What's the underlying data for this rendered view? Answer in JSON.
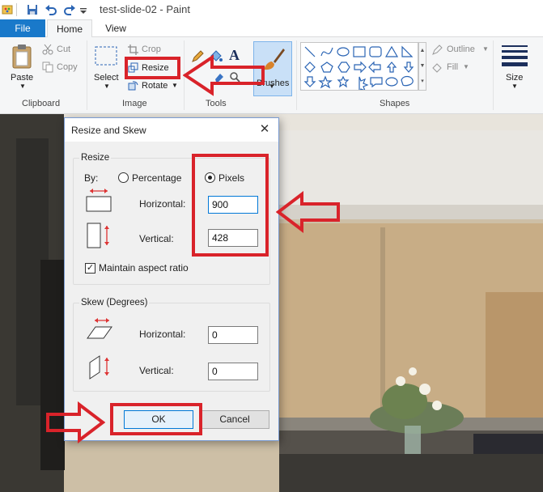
{
  "window": {
    "title": "test-slide-02 - Paint"
  },
  "tabs": {
    "file": "File",
    "home": "Home",
    "view": "View"
  },
  "ribbon": {
    "clipboard": {
      "paste": "Paste",
      "cut": "Cut",
      "copy": "Copy",
      "group": "Clipboard"
    },
    "image": {
      "select": "Select",
      "crop": "Crop",
      "resize": "Resize",
      "rotate": "Rotate",
      "group": "Image"
    },
    "tools": {
      "group": "Tools"
    },
    "brushes": {
      "label": "Brushes"
    },
    "shapes": {
      "outline": "Outline",
      "fill": "Fill",
      "group": "Shapes"
    },
    "size": {
      "label": "Size"
    }
  },
  "dialog": {
    "title": "Resize and Skew",
    "resize": {
      "legend": "Resize",
      "by_label": "By:",
      "percentage": "Percentage",
      "pixels": "Pixels",
      "selected_mode": "Pixels",
      "horizontal_label": "Horizontal:",
      "horizontal_value": "900",
      "vertical_label": "Vertical:",
      "vertical_value": "428",
      "maintain_aspect": "Maintain aspect ratio",
      "maintain_checked": true
    },
    "skew": {
      "legend": "Skew (Degrees)",
      "horizontal_label": "Horizontal:",
      "horizontal_value": "0",
      "vertical_label": "Vertical:",
      "vertical_value": "0"
    },
    "ok": "OK",
    "cancel": "Cancel"
  },
  "colors": {
    "accent": "#1979ca",
    "annotation": "#d9232a",
    "ribbon_bg": "#f5f6f7",
    "dialog_bg": "#f0f0f0"
  }
}
